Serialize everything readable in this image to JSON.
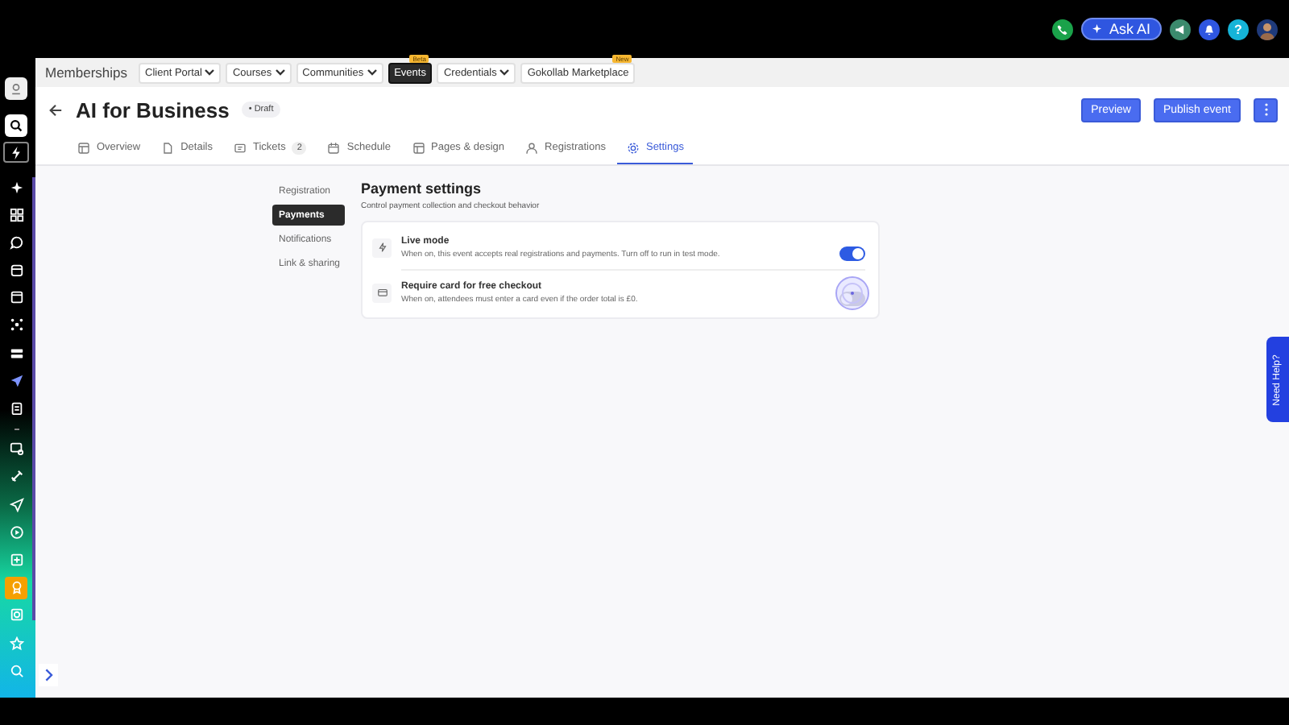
{
  "top_bar": {
    "ask_ai": "Ask AI",
    "help": "?"
  },
  "nav": {
    "title": "Memberships",
    "items": [
      {
        "label": "Client Portal",
        "dropdown": true,
        "selected": false
      },
      {
        "label": "Courses",
        "dropdown": true,
        "selected": false
      },
      {
        "label": "Communities",
        "dropdown": true,
        "selected": false
      },
      {
        "label": "Events",
        "dropdown": false,
        "selected": true,
        "badge": "Beta"
      },
      {
        "label": "Credentials",
        "dropdown": true,
        "selected": false
      },
      {
        "label": "Gokollab Marketplace",
        "dropdown": false,
        "selected": false,
        "badge": "New"
      }
    ]
  },
  "header": {
    "title": "AI for Business",
    "status": "• Draft",
    "buttons": [
      {
        "label": "Preview"
      },
      {
        "label": "Publish event"
      }
    ]
  },
  "tabs": [
    {
      "label": "Overview",
      "selected": false
    },
    {
      "label": "Details",
      "selected": false
    },
    {
      "label": "Tickets",
      "selected": false,
      "count": "2"
    },
    {
      "label": "Schedule",
      "selected": false
    },
    {
      "label": "Pages & design",
      "selected": false
    },
    {
      "label": "Registrations",
      "selected": false
    },
    {
      "label": "Settings",
      "selected": true
    }
  ],
  "settings_menu": [
    {
      "label": "Registration",
      "selected": false
    },
    {
      "label": "Payments",
      "selected": true
    },
    {
      "label": "Notifications",
      "selected": false
    },
    {
      "label": "Link & sharing",
      "selected": false
    }
  ],
  "section": {
    "title": "Payment settings",
    "subtitle": "Control payment collection and checkout behavior",
    "rows": [
      {
        "title": "Live mode",
        "description": "When on, this event accepts real registrations and payments. Turn off to run in test mode.",
        "on": true
      },
      {
        "title": "Require card for free checkout",
        "description": "When on, attendees must enter a card even if the order total is £0.",
        "on": false
      }
    ]
  },
  "help_tab": "Need Help?"
}
